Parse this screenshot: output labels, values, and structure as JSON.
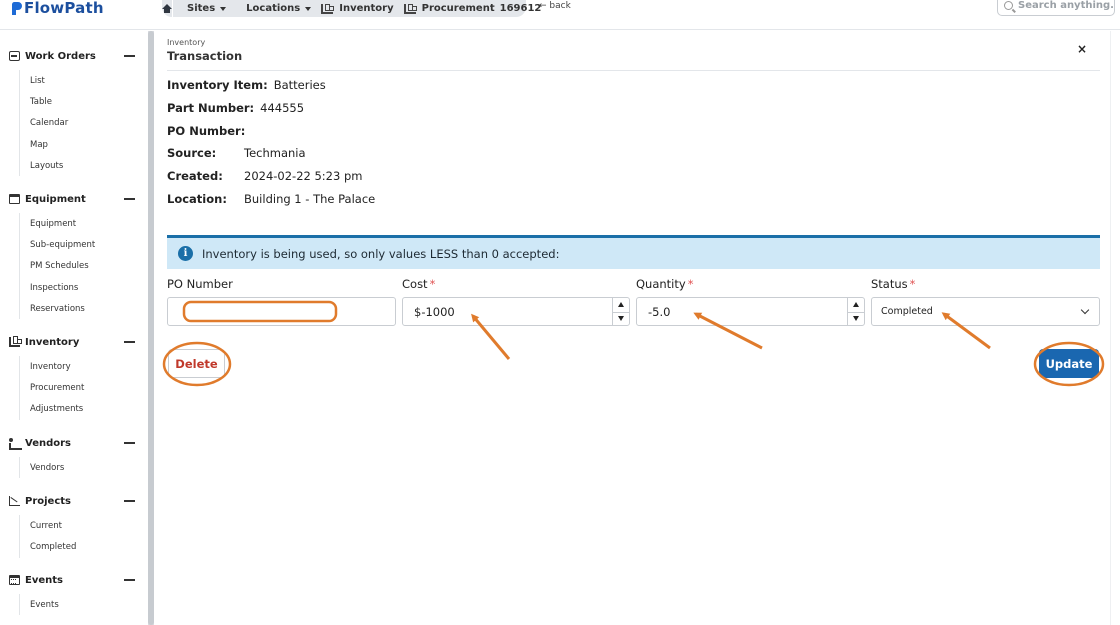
{
  "brand": {
    "name": "FlowPath"
  },
  "breadcrumb": {
    "items": [
      {
        "label": "Sites"
      },
      {
        "label": "Locations"
      },
      {
        "label": "Inventory"
      },
      {
        "label": "Procurement"
      }
    ],
    "record_id": "169612",
    "back_label": "← back"
  },
  "search": {
    "placeholder": "Search anything..."
  },
  "sidebar": {
    "sections": [
      {
        "title": "Work Orders",
        "icon": "work-orders-icon",
        "items": [
          "List",
          "Table",
          "Calendar",
          "Map",
          "Layouts"
        ]
      },
      {
        "title": "Equipment",
        "icon": "equipment-icon",
        "items": [
          "Equipment",
          "Sub-equipment",
          "PM Schedules",
          "Inspections",
          "Reservations"
        ]
      },
      {
        "title": "Inventory",
        "icon": "inventory-icon",
        "items": [
          "Inventory",
          "Procurement",
          "Adjustments"
        ]
      },
      {
        "title": "Vendors",
        "icon": "vendors-icon",
        "items": [
          "Vendors"
        ]
      },
      {
        "title": "Projects",
        "icon": "projects-icon",
        "items": [
          "Current",
          "Completed"
        ]
      },
      {
        "title": "Events",
        "icon": "events-icon",
        "items": [
          "Events"
        ]
      }
    ]
  },
  "panel": {
    "eyebrow": "Inventory",
    "title": "Transaction",
    "close_label": "×",
    "details": [
      {
        "label": "Inventory Item:",
        "value": "Batteries"
      },
      {
        "label": "Part Number:",
        "value": "444555"
      },
      {
        "label": "PO Number:",
        "value": ""
      },
      {
        "label": "Source:",
        "value": "Techmania"
      },
      {
        "label": "Created:",
        "value": "2024-02-22 5:23 pm"
      },
      {
        "label": "Location:",
        "value": "Building 1 - The Palace"
      }
    ],
    "alert": {
      "icon_glyph": "i",
      "text": "Inventory is being used, so only values LESS than 0 accepted:"
    },
    "form": {
      "po_number": {
        "label": "PO Number",
        "value": ""
      },
      "cost": {
        "label": "Cost",
        "required_mark": "*",
        "value": "$-1000"
      },
      "quantity": {
        "label": "Quantity",
        "required_mark": "*",
        "value": "-5.0"
      },
      "status": {
        "label": "Status",
        "required_mark": "*",
        "value": "Completed"
      }
    },
    "buttons": {
      "delete": "Delete",
      "update": "Update"
    }
  },
  "colors": {
    "brand": "#1c4f9e",
    "primary_button": "#1a67b0",
    "danger_text": "#c0392b",
    "alert_bg": "#cfe8f7",
    "annotation": "#e07b2c"
  }
}
